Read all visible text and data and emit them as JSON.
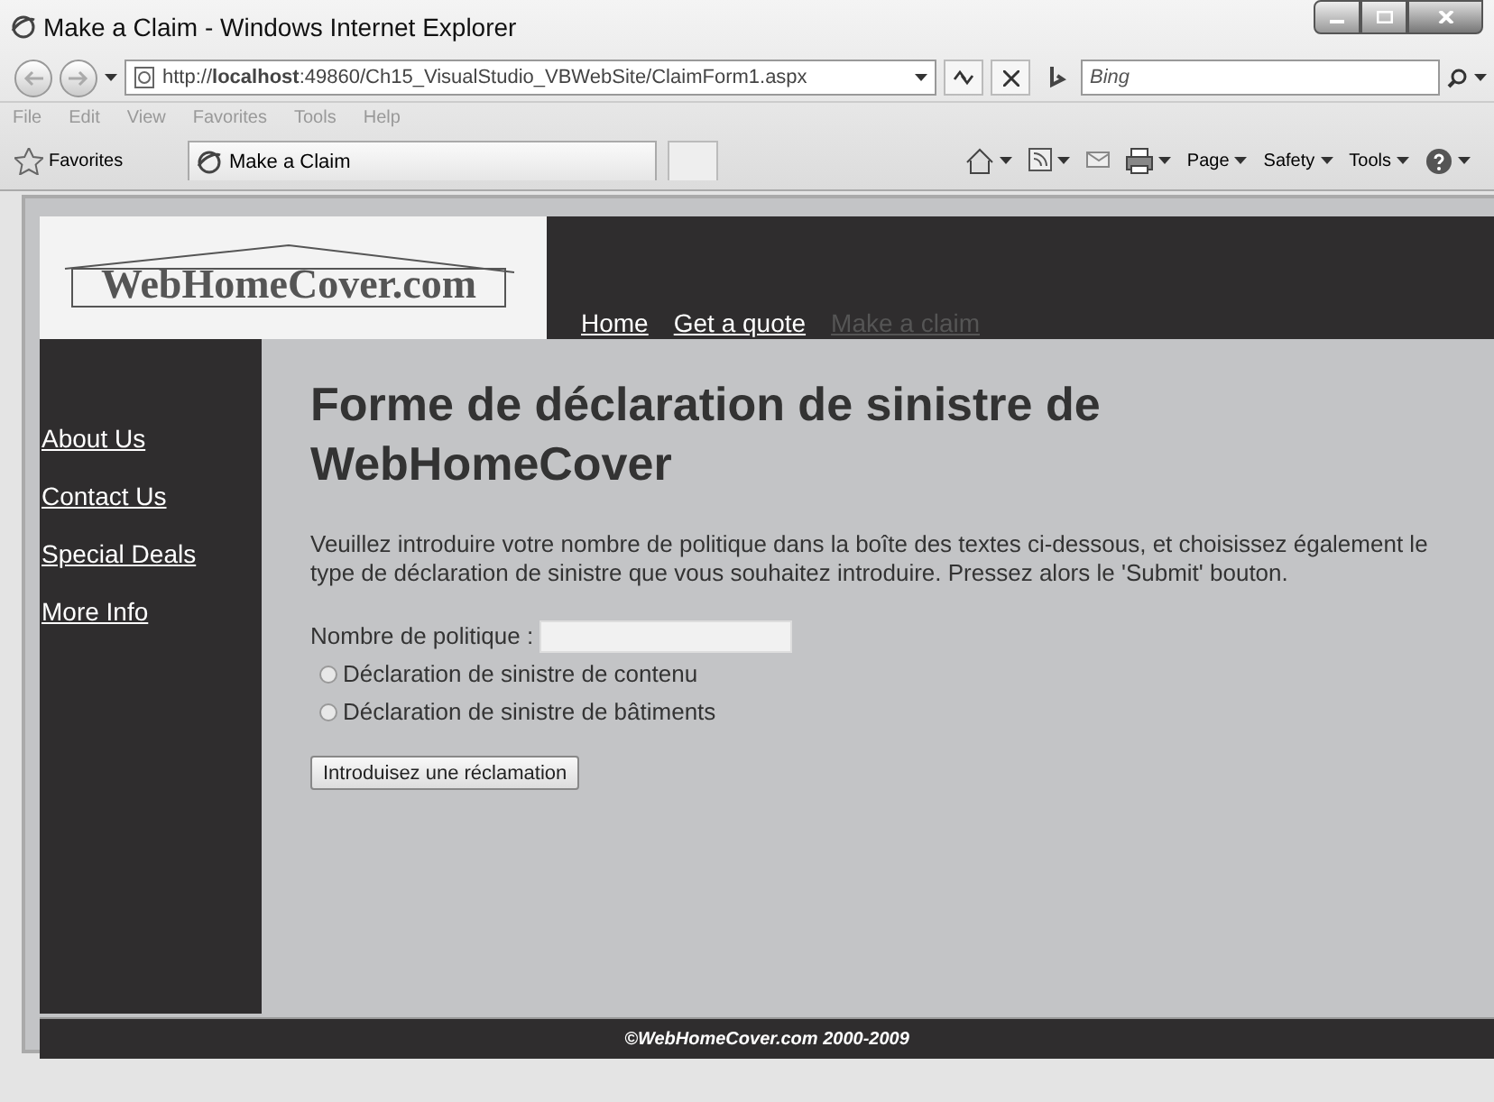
{
  "window": {
    "title": "Make a Claim - Windows Internet Explorer"
  },
  "address_bar": {
    "url": "http://**localhost**:49860/Ch15_VisualStudio_VBWebSite/ClaimForm1.aspx"
  },
  "search": {
    "placeholder": "Bing"
  },
  "menu": [
    "File",
    "Edit",
    "View",
    "Favorites",
    "Tools",
    "Help"
  ],
  "favorites": {
    "label": "Favorites"
  },
  "tabs": [
    {
      "label": "Make a Claim",
      "selected": true
    }
  ],
  "command_bar": [
    "Page",
    "Safety",
    "Tools"
  ],
  "site": {
    "logo": "WebHomeCover.com",
    "nav": [
      {
        "label": "Home",
        "selected": false
      },
      {
        "label": "Get a quote",
        "selected": false
      },
      {
        "label": "Make a claim",
        "selected": true
      }
    ],
    "sidebar": [
      "About Us",
      "Contact Us",
      "Special Deals",
      "More Info"
    ],
    "heading": "Forme de déclaration de sinistre de WebHomeCover",
    "intro": "Veuillez introduire votre nombre de politique dans la boîte des textes ci-dessous, et choisissez également le type de déclaration de sinistre que vous souhaitez introduire. Pressez alors le 'Submit' bouton.",
    "field_label": "Nombre de politique :",
    "options": [
      {
        "label": "Déclaration de sinistre de contenu",
        "selected": false
      },
      {
        "label": "Déclaration de sinistre de bâtiments",
        "selected": false
      }
    ],
    "submit": "Introduisez une réclamation",
    "footer": "©WebHomeCover.com 2000-2009"
  }
}
